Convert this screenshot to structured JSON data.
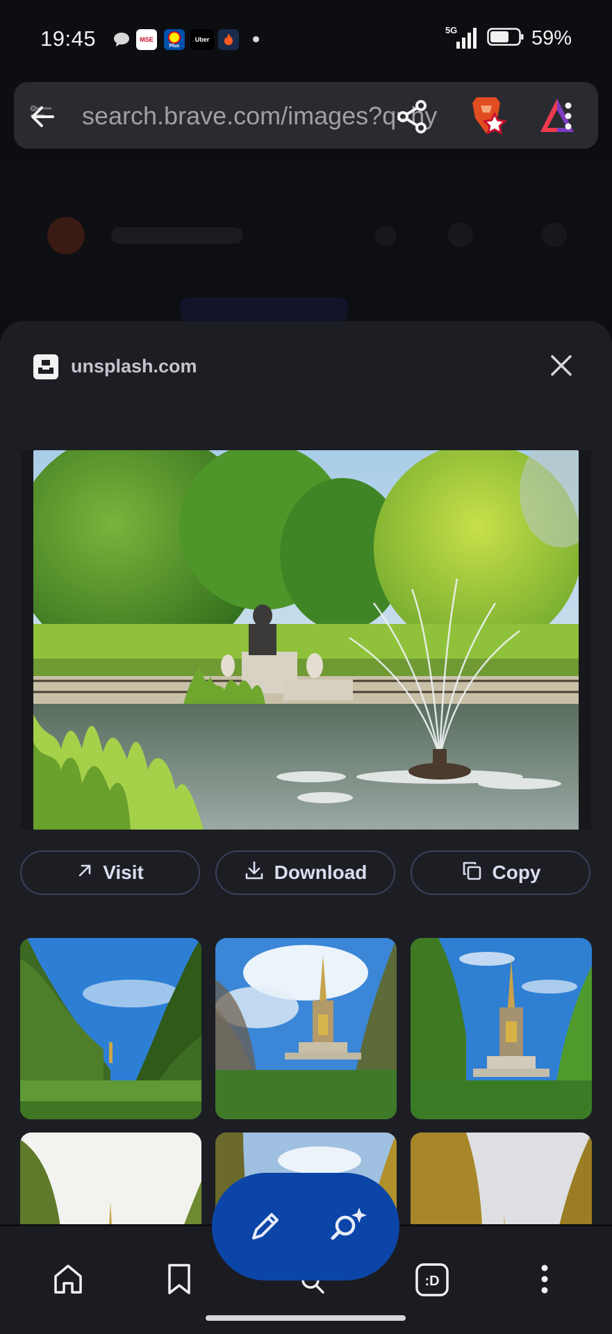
{
  "status_bar": {
    "time": "19:45",
    "notifications": [
      {
        "icon": "chat-bubble-icon",
        "label": ""
      },
      {
        "icon": "mse-app-icon",
        "label": "MSE",
        "bg": "#ffffff",
        "fg": "#c8102e"
      },
      {
        "icon": "lidl-plus-icon",
        "label": "Plus",
        "bg": "#0050aa",
        "fg": "#fff000"
      },
      {
        "icon": "uber-icon",
        "label": "Uber",
        "bg": "#000000",
        "fg": "#ffffff"
      },
      {
        "icon": "flame-app-icon",
        "label": "",
        "bg": "#1a2a4a",
        "fg": "#ff5a1f"
      }
    ],
    "network": "5G",
    "battery": "59%"
  },
  "browser": {
    "url": "search.brave.com/images?q=hy",
    "icons": [
      "back-arrow-icon",
      "share-icon",
      "brave-lion-icon",
      "brave-rewards-icon",
      "menu-dots-icon"
    ]
  },
  "sheet": {
    "site": "unsplash.com",
    "actions": {
      "visit": "Visit",
      "download": "Download",
      "copy": "Copy"
    }
  },
  "colors": {
    "sheet_bg": "#1d1e24",
    "accent_fab": "#0c45a8",
    "button_border": "#3d3f5c"
  },
  "bottom_nav": {
    "icons": [
      "home-icon",
      "bookmark-icon",
      "search-icon",
      "playlist-icon",
      "more-icon"
    ],
    "fab_icons": [
      "pencil-icon",
      "ai-search-sparkle-icon"
    ]
  }
}
